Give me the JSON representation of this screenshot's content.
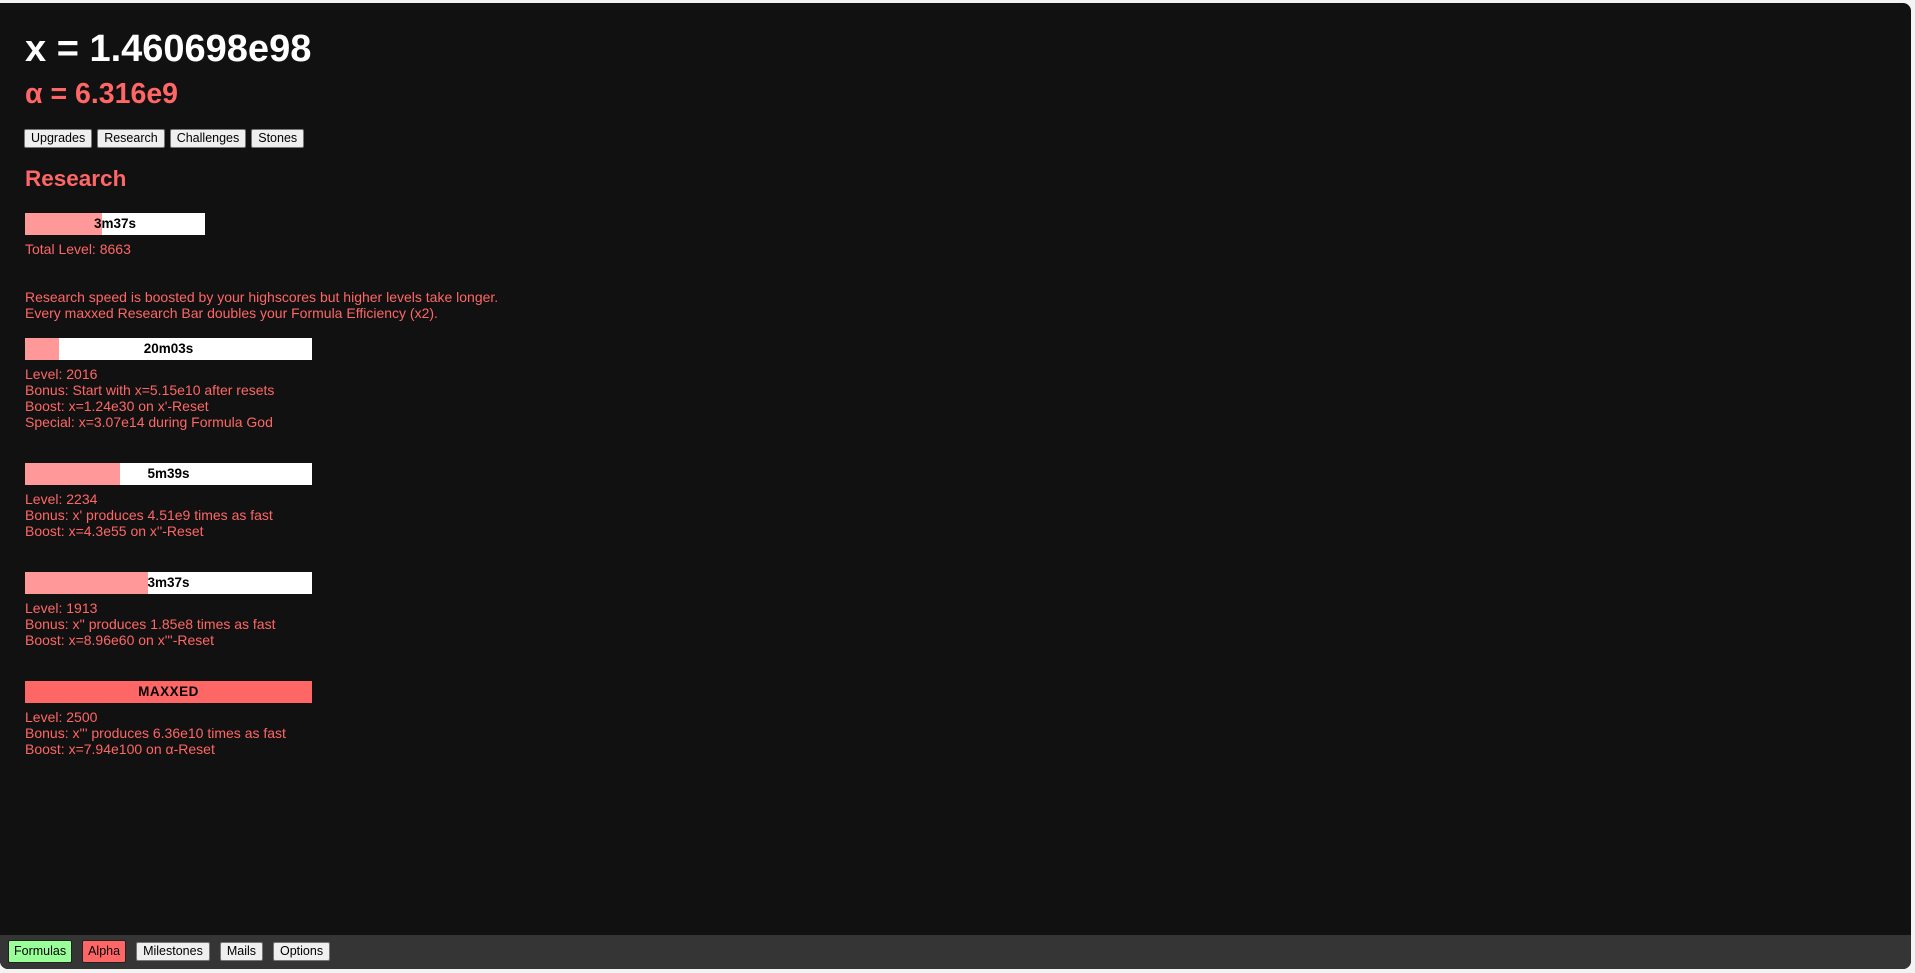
{
  "header": {
    "x_value": "x = 1.460698e98",
    "alpha_value": "α = 6.316e9"
  },
  "subtabs": [
    {
      "label": "Upgrades"
    },
    {
      "label": "Research"
    },
    {
      "label": "Challenges"
    },
    {
      "label": "Stones"
    }
  ],
  "research": {
    "title": "Research",
    "total_bar": {
      "label": "3m37s",
      "progress_percent": 43
    },
    "total_level": "Total Level: 8663",
    "info_lines": [
      "Research speed is boosted by your highscores but higher levels take longer.",
      "Every maxxed Research Bar doubles your Formula Efficiency (x2)."
    ],
    "bars": [
      {
        "label": "20m03s",
        "progress_percent": 12,
        "maxxed": false,
        "lines": [
          "Level: 2016",
          "Bonus: Start with x=5.15e10 after resets",
          "Boost: x=1.24e30 on x'-Reset",
          "Special: x=3.07e14 during Formula God"
        ]
      },
      {
        "label": "5m39s",
        "progress_percent": 33,
        "maxxed": false,
        "lines": [
          "Level: 2234",
          "Bonus: x' produces 4.51e9 times as fast",
          "Boost: x=4.3e55 on x''-Reset"
        ]
      },
      {
        "label": "3m37s",
        "progress_percent": 43,
        "maxxed": false,
        "lines": [
          "Level: 1913",
          "Bonus: x'' produces 1.85e8 times as fast",
          "Boost: x=8.96e60 on x'''-Reset"
        ]
      },
      {
        "label": "MAXXED",
        "progress_percent": 100,
        "maxxed": true,
        "lines": [
          "Level: 2500",
          "Bonus: x''' produces 6.36e10 times as fast",
          "Boost: x=7.94e100 on α-Reset"
        ]
      }
    ]
  },
  "bottom_nav": [
    {
      "label": "Formulas",
      "color": "#99ff99"
    },
    {
      "label": "Alpha",
      "color": "#ff6666"
    },
    {
      "label": "Milestones"
    },
    {
      "label": "Mails"
    },
    {
      "label": "Options"
    }
  ],
  "colors": {
    "background": "#111111",
    "accent_red": "#ff6666",
    "bar_fill": "#ff9999",
    "bottom_bar": "#353535"
  }
}
